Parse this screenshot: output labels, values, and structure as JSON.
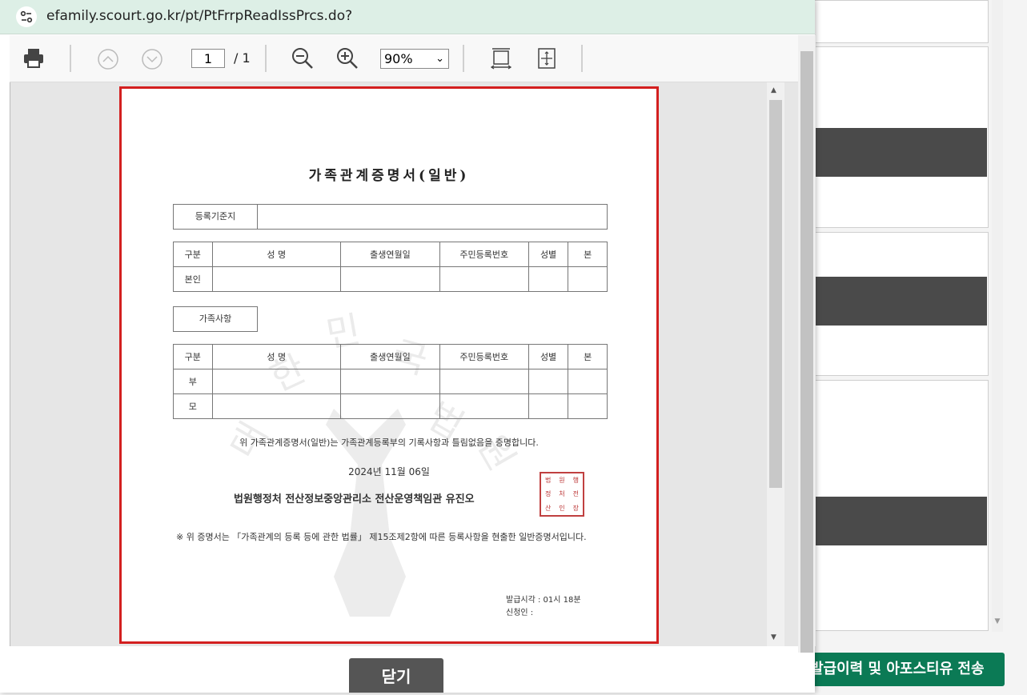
{
  "address_bar": {
    "url": "efamily.scourt.go.kr/pt/PtFrrpReadIssPrcs.do?"
  },
  "toolbar": {
    "page_current": "1",
    "page_sep_total": "/  1",
    "zoom": "90%"
  },
  "document": {
    "title": "가족관계증명서(일반)",
    "reg_base_label": "등록기준지",
    "columns": [
      "구분",
      "성    명",
      "출생연월일",
      "주민등록번호",
      "성별",
      "본"
    ],
    "self_row_label": "본인",
    "family_label": "가족사항",
    "family_rows": [
      "부",
      "모"
    ],
    "statement": "위 가족관계증명서(일반)는 가족관계등록부의 기록사항과 틀림없음을 증명합니다.",
    "date": "2024년 11월 06일",
    "issuer": "법원행정처 전산정보중앙관리소 전산운영책임관 유진오",
    "note": "※ 위 증명서는 「가족관계의 등록 등에 관한 법률」 제15조제2항에 따른 등록사항을 현출한 일반증명서입니다.",
    "issue_time": "발급시각 : 01시 18분",
    "applicant": "신청인 :",
    "watermark_chars": [
      "대",
      "한",
      "민",
      "국",
      "법",
      "원"
    ]
  },
  "close_button": "닫기",
  "background": {
    "send_button": "발급이력 및 아포스티유 전송"
  },
  "colors": {
    "doc_border": "#d31f1f",
    "send_button": "#0b7a55",
    "addr_bar": "#ddefe6"
  }
}
